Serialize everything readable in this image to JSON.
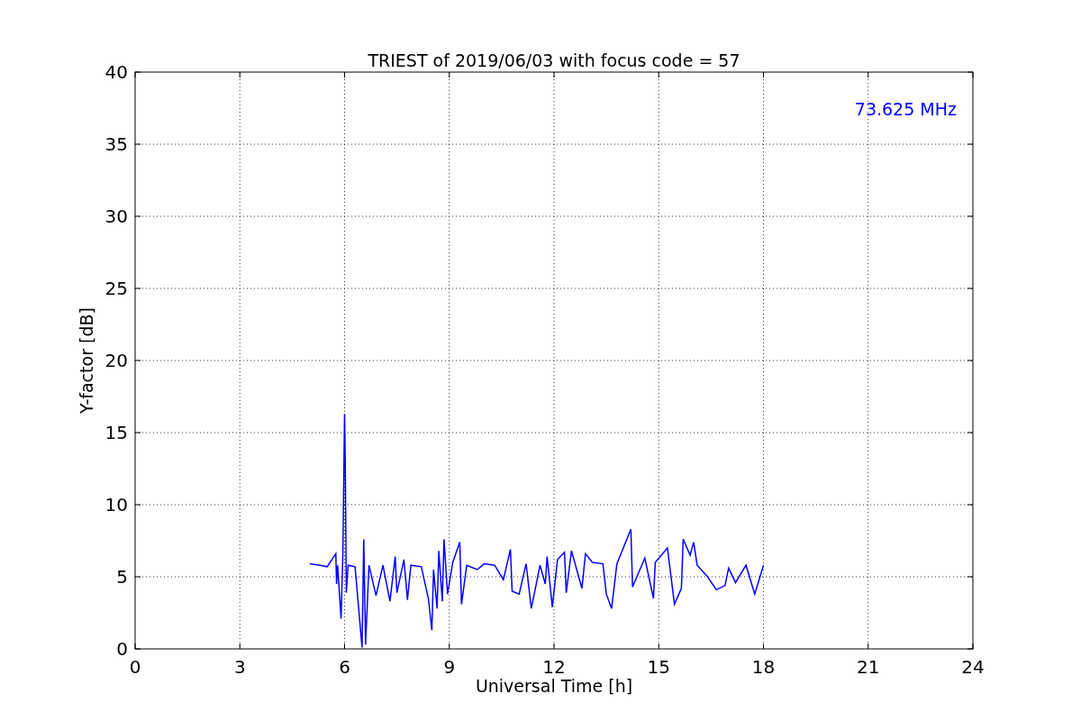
{
  "chart_data": {
    "type": "line",
    "title": "TRIEST of 2019/06/03 with focus code = 57",
    "xlabel": "Universal Time [h]",
    "ylabel": "Y-factor [dB]",
    "x": [
      5.0,
      5.3,
      5.5,
      5.75,
      5.77,
      5.8,
      5.9,
      5.95,
      6.0,
      6.02,
      6.05,
      6.1,
      6.3,
      6.35,
      6.5,
      6.55,
      6.6,
      6.7,
      6.9,
      7.1,
      7.3,
      7.45,
      7.5,
      7.7,
      7.8,
      7.9,
      8.2,
      8.4,
      8.5,
      8.55,
      8.65,
      8.7,
      8.8,
      8.85,
      8.95,
      9.1,
      9.3,
      9.35,
      9.5,
      9.8,
      10.0,
      10.3,
      10.55,
      10.75,
      10.8,
      11.0,
      11.2,
      11.35,
      11.6,
      11.75,
      11.8,
      11.95,
      12.1,
      12.3,
      12.35,
      12.5,
      12.8,
      12.9,
      13.1,
      13.4,
      13.5,
      13.65,
      13.8,
      14.2,
      14.25,
      14.6,
      14.85,
      14.9,
      15.25,
      15.45,
      15.65,
      15.7,
      15.9,
      16.0,
      16.1,
      16.4,
      16.65,
      16.9,
      17.0,
      17.2,
      17.5,
      17.75,
      18.0
    ],
    "series": [
      {
        "name": "73.625 MHz",
        "color": "#0000ff",
        "values": [
          5.9,
          5.8,
          5.7,
          6.6,
          4.5,
          5.8,
          2.1,
          6.5,
          16.3,
          12.8,
          3.9,
          5.8,
          5.7,
          4.3,
          0.1,
          7.6,
          0.3,
          5.8,
          3.7,
          5.8,
          3.3,
          6.4,
          3.9,
          6.2,
          3.4,
          5.8,
          5.7,
          3.5,
          1.3,
          5.5,
          2.8,
          6.8,
          3.3,
          7.6,
          3.8,
          6.0,
          7.4,
          3.1,
          5.8,
          5.5,
          5.9,
          5.8,
          4.8,
          6.9,
          4.0,
          3.8,
          5.9,
          2.8,
          5.8,
          4.5,
          6.4,
          2.9,
          6.2,
          6.7,
          3.9,
          6.8,
          4.2,
          6.6,
          6.0,
          5.9,
          3.8,
          2.8,
          5.9,
          8.3,
          4.3,
          6.3,
          3.5,
          6.0,
          7.0,
          3.1,
          4.2,
          7.6,
          6.5,
          7.4,
          5.8,
          5.0,
          4.1,
          4.4,
          5.6,
          4.6,
          5.8,
          3.8,
          5.8
        ]
      }
    ],
    "xlim": [
      0,
      24
    ],
    "ylim": [
      0,
      40
    ],
    "xticks": [
      0,
      3,
      6,
      9,
      12,
      15,
      18,
      21,
      24
    ],
    "yticks": [
      0,
      5,
      10,
      15,
      20,
      25,
      30,
      35,
      40
    ],
    "grid": true
  }
}
